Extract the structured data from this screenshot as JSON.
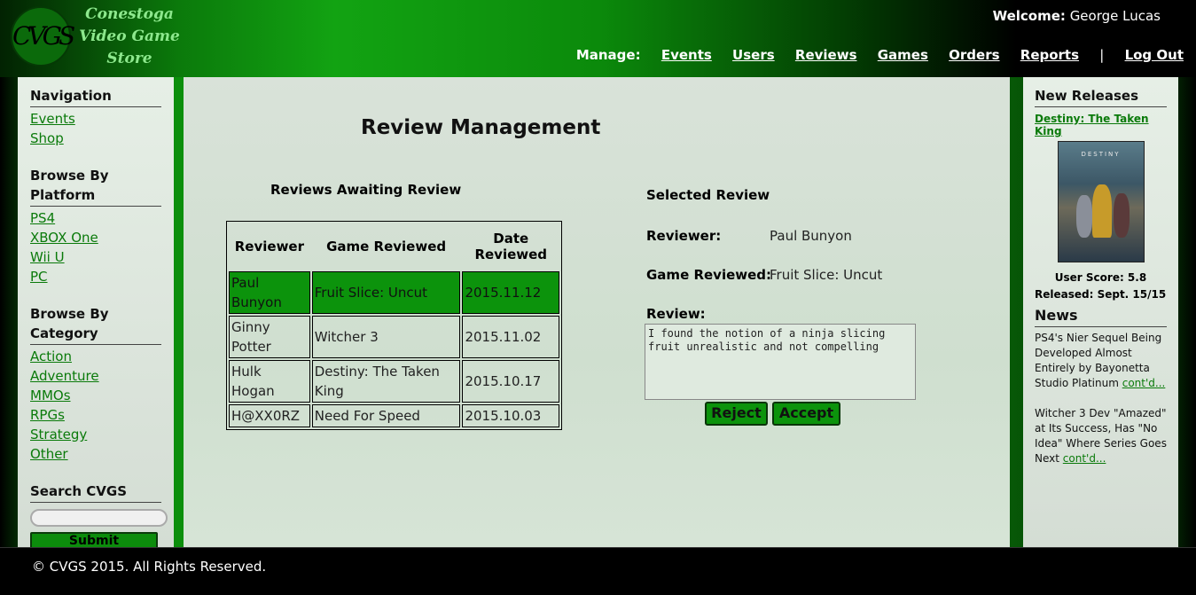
{
  "header": {
    "logo_initials": "CVGS",
    "logo_text": [
      "Conestoga",
      "Video Game",
      "Store"
    ],
    "welcome_label": "Welcome:",
    "welcome_user": "George Lucas",
    "manage_label": "Manage:",
    "nav": [
      "Events",
      "Users",
      "Reviews",
      "Games",
      "Orders",
      "Reports"
    ],
    "separator": "|",
    "logout": "Log Out"
  },
  "sidebar": {
    "navigation_title": "Navigation",
    "navigation_links": [
      "Events",
      "Shop"
    ],
    "platform_title": "Browse By Platform",
    "platform_links": [
      "PS4",
      "XBOX One",
      "Wii U",
      "PC"
    ],
    "category_title": "Browse By Category",
    "category_links": [
      "Action",
      "Adventure",
      "MMOs",
      "RPGs",
      "Strategy",
      "Other"
    ],
    "search_title": "Search CVGS",
    "search_value": "",
    "submit_label": "Submit"
  },
  "main": {
    "title": "Review Management",
    "awaiting_title": "Reviews Awaiting Review",
    "table": {
      "headers": [
        "Reviewer",
        "Game Reviewed",
        "Date Reviewed"
      ],
      "rows": [
        {
          "reviewer": "Paul Bunyon",
          "game": "Fruit Slice: Uncut",
          "date": "2015.11.12",
          "selected": true
        },
        {
          "reviewer": "Ginny Potter",
          "game": "Witcher 3",
          "date": "2015.11.02",
          "selected": false
        },
        {
          "reviewer": "Hulk Hogan",
          "game": "Destiny: The Taken King",
          "date": "2015.10.17",
          "selected": false
        },
        {
          "reviewer": "H@XX0RZ",
          "game": "Need For Speed",
          "date": "2015.10.03",
          "selected": false
        }
      ]
    },
    "selected": {
      "title": "Selected Review",
      "reviewer_label": "Reviewer:",
      "reviewer_value": "Paul Bunyon",
      "game_label": "Game Reviewed:",
      "game_value": "Fruit Slice: Uncut",
      "review_label": "Review:",
      "review_text": "I found the notion of a ninja slicing fruit unrealistic and not compelling",
      "reject_label": "Reject",
      "accept_label": "Accept"
    }
  },
  "right": {
    "new_releases_title": "New Releases",
    "release_link": "Destiny: The Taken King",
    "cover_text": "DESTINY",
    "user_score": "User Score: 5.8",
    "released": "Released: Sept. 15/15",
    "news_title": "News",
    "news": [
      {
        "text": "PS4's Nier Sequel Being Developed Almost Entirely by Bayonetta Studio Platinum",
        "link": "cont'd..."
      },
      {
        "text": "Witcher 3 Dev \"Amazed\" at Its Success, Has \"No Idea\" Where Series Goes Next",
        "link": "cont'd..."
      }
    ]
  },
  "footer": {
    "copyright": "© CVGS 2015. All Rights Reserved."
  },
  "colors": {
    "accent_green": "#0c930c",
    "link_green": "#0a7a0a",
    "panel_bg": "#d9e2d9"
  }
}
